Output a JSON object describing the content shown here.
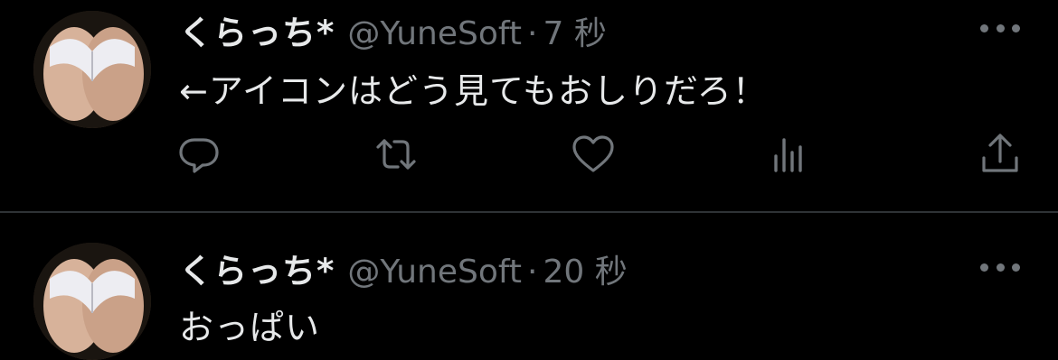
{
  "tweets": [
    {
      "display_name": "くらっち*",
      "handle": "@YuneSoft",
      "separator": "·",
      "time": "7 秒",
      "text": "←アイコンはどう見てもおしりだろ！",
      "actions": [
        "reply-icon",
        "retweet-icon",
        "like-icon",
        "views-icon",
        "share-icon"
      ]
    },
    {
      "display_name": "くらっち*",
      "handle": "@YuneSoft",
      "separator": "·",
      "time": "20 秒",
      "text": "おっぱい"
    }
  ],
  "colors": {
    "background": "#000000",
    "primary_text": "#e7e9ea",
    "secondary_text": "#71767b",
    "divider": "#2f3336"
  }
}
